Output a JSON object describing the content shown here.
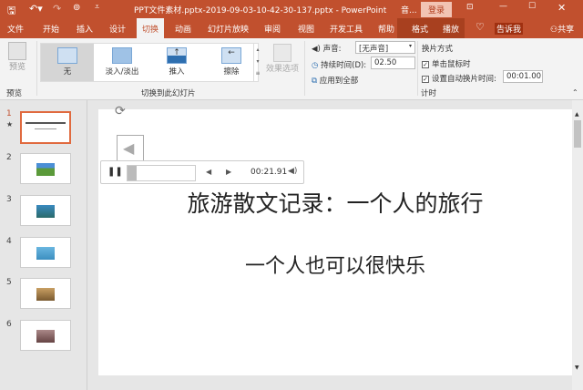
{
  "titlebar": {
    "title": "PPT文件素材.pptx-2019-09-03-10-42-30-137.pptx  -  PowerPoint",
    "context": "音...",
    "login": "登录"
  },
  "tabs": [
    "文件",
    "开始",
    "插入",
    "设计",
    "切换",
    "动画",
    "幻灯片放映",
    "审阅",
    "视图",
    "开发工具",
    "帮助",
    "格式",
    "播放"
  ],
  "active_tab": "切换",
  "tell_me": "告诉我",
  "share": "共享",
  "ribbon": {
    "preview": "预览",
    "preview_group": "预览",
    "transitions": [
      "无",
      "淡入/淡出",
      "推入",
      "擦除"
    ],
    "effect_options": "效果选项",
    "transition_group": "切换到此幻灯片",
    "sound_label": "声音:",
    "sound_value": "[无声音]",
    "duration_label": "持续时间(D):",
    "duration_value": "02.50",
    "apply_all": "应用到全部",
    "advance_label": "换片方式",
    "on_click": "单击鼠标时",
    "on_click_checked": true,
    "after_label": "设置自动换片时间:",
    "after_checked": true,
    "after_value": "00:01.00",
    "timing_group": "计时"
  },
  "thumbnails": [
    "1",
    "2",
    "3",
    "4",
    "5",
    "6"
  ],
  "player": {
    "time": "00:21.91",
    "playing": true
  },
  "slide": {
    "title": "旅游散文记录：一个人的旅行",
    "subtitle": "一个人也可以很快乐"
  }
}
